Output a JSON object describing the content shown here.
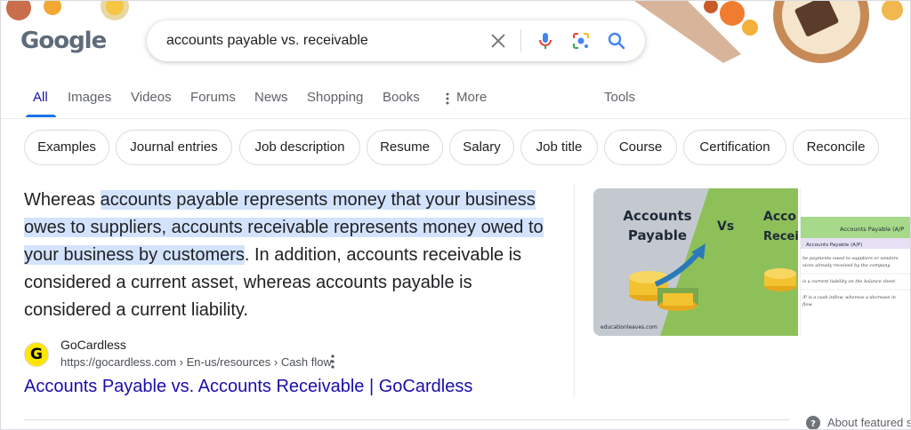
{
  "logo": {
    "text": "Google"
  },
  "search": {
    "query": "accounts payable vs. receivable"
  },
  "tabs": [
    {
      "label": "All"
    },
    {
      "label": "Images"
    },
    {
      "label": "Videos"
    },
    {
      "label": "Forums"
    },
    {
      "label": "News"
    },
    {
      "label": "Shopping"
    },
    {
      "label": "Books"
    },
    {
      "label": "More"
    },
    {
      "label": "Tools"
    }
  ],
  "chips": [
    {
      "label": "Examples"
    },
    {
      "label": "Journal entries"
    },
    {
      "label": "Job description"
    },
    {
      "label": "Resume"
    },
    {
      "label": "Salary"
    },
    {
      "label": "Job title"
    },
    {
      "label": "Course"
    },
    {
      "label": "Certification"
    },
    {
      "label": "Reconcile"
    }
  ],
  "snippet": {
    "prefix": "Whereas ",
    "highlight": "accounts payable represents money that your business owes to suppliers, accounts receivable represents money owed to your business by customers",
    "suffix": ". In addition, accounts receivable is considered a current asset, whereas accounts payable is considered a current liability."
  },
  "source": {
    "favicon_letter": "G",
    "name": "GoCardless",
    "url": "https://gocardless.com › En-us/resources › Cash flow"
  },
  "result": {
    "title": "Accounts Payable vs. Accounts Receivable | GoCardless"
  },
  "image": {
    "left_title_1": "Accounts",
    "left_title_2": "Payable",
    "vs": "Vs",
    "right_title_1": "Acco",
    "right_title_2": "Recei",
    "watermark": "educationleaves.com"
  },
  "image2": {
    "header": "Accounts Payable (A/P",
    "subheader": "Accounts Payable (A/P)",
    "line1": "he payments owed to suppliers or vendors",
    "line2": "vices already received by the company.",
    "line3": "is a current liability on the balance sheet.",
    "line4": "/P is a cash inflow, whereas a decrease in",
    "line5": "flow."
  },
  "footer": {
    "about": "About featured sı"
  },
  "colors": {
    "link": "#1a0dab",
    "highlight": "#d3e3fd",
    "active_tab": "#1a73e8"
  }
}
